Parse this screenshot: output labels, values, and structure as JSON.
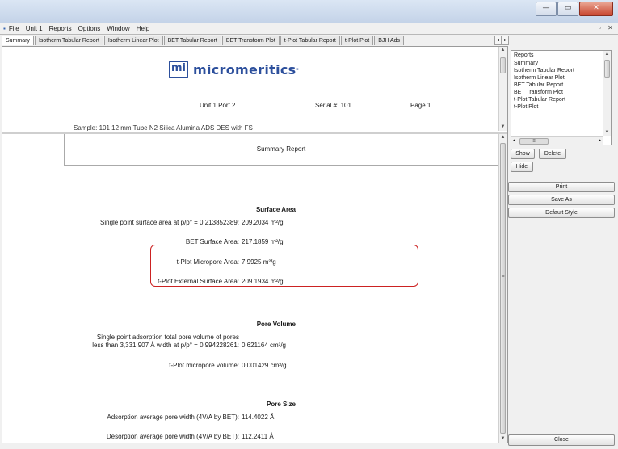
{
  "window": {
    "minimize": "—",
    "maximize": "▭",
    "close": "✕"
  },
  "menu": {
    "app_icon": "▪",
    "items": [
      "File",
      "Unit 1",
      "Reports",
      "Options",
      "Window",
      "Help"
    ],
    "mdi_minimize": "_",
    "mdi_restore": "▫",
    "mdi_close": "✕"
  },
  "tabs": [
    "Summary",
    "Isotherm Tabular Report",
    "Isotherm Linear Plot",
    "BET Tabular Report",
    "BET Transform Plot",
    "t-Plot Tabular Report",
    "t-Plot Plot",
    "BJH Ads"
  ],
  "tab_scroll": {
    "left": "◂",
    "right": "▸"
  },
  "header": {
    "logo_mark": "mi",
    "logo_text": "micromeritics",
    "logo_reg": "·",
    "port": "Unit 1 Port 2",
    "serial": "Serial #: 101",
    "page": "Page 1",
    "sample": "Sample: 101 12 mm Tube N2 Silica Alumina ADS DES with FS"
  },
  "report": {
    "title": "Summary Report",
    "surface_area": {
      "heading": "Surface Area",
      "single_point_label": "Single point surface area at p/p° = 0.213852389:",
      "single_point_value": "209.2034 m²/g",
      "bet_label": "BET Surface Area:",
      "bet_value": "217.1859 m²/g",
      "tplot_micro_label": "t-Plot Micropore Area:",
      "tplot_micro_value": "7.9925 m²/g",
      "tplot_external_label": "t-Plot External Surface Area:",
      "tplot_external_value": "209.1934 m²/g"
    },
    "pore_volume": {
      "heading": "Pore Volume",
      "single_point_line1": "Single point adsorption total pore volume of pores",
      "single_point_line2": "less than 3,331.907 Å width at p/p° = 0.994228261:",
      "single_point_value": "0.621164 cm³/g",
      "tplot_label": "t-Plot micropore volume:",
      "tplot_value": "0.001429 cm³/g"
    },
    "pore_size": {
      "heading": "Pore Size",
      "ads_label": "Adsorption average pore width (4V/A by BET):",
      "ads_value": "114.4022 Å",
      "des_label": "Desorption average pore width (4V/A by BET):",
      "des_value": "112.2411 Å"
    }
  },
  "scroll": {
    "up": "▲",
    "down": "▼",
    "grip": "≡"
  },
  "reports_panel": {
    "header": "Reports",
    "items": [
      "Summary",
      "Isotherm Tabular Report",
      "Isotherm Linear Plot",
      "BET Tabular Report",
      "BET Transform Plot",
      "t-Plot Tabular Report",
      "t-Plot Plot"
    ],
    "hscroll_left": "◂",
    "hscroll_right": "▸",
    "hscroll_grip": "≡"
  },
  "buttons": {
    "show": "Show",
    "delete": "Delete",
    "hide": "Hide",
    "print": "Print",
    "save_as": "Save As",
    "default_style": "Default Style",
    "close": "Close"
  }
}
